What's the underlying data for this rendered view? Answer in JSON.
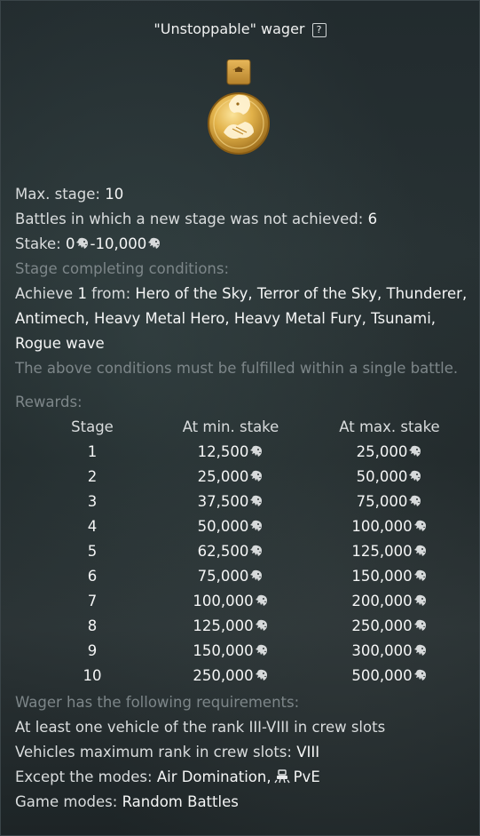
{
  "title": "\"Unstoppable\" wager",
  "help_glyph": "?",
  "medal_icon": "golden-lion-handshake-medal",
  "colors": {
    "muted": "#7d8689",
    "value": "#f4f5f5",
    "gold": "#d7a53a"
  },
  "max_stage": {
    "label": "Max. stage: ",
    "value": "10"
  },
  "battles_not_achieved": {
    "label": "Battles in which a new stage was not achieved: ",
    "value": "6"
  },
  "stake": {
    "label": "Stake: ",
    "min": "0",
    "separator": "-",
    "max": "10,000",
    "currency_icon": "lion-icon"
  },
  "conditions": {
    "title": "Stage completing conditions:",
    "achieve_prefix": "Achieve ",
    "achieve_count": "1",
    "achieve_from": " from: ",
    "list": "Hero of the Sky, Terror of the Sky, Thunderer, Antimech, Heavy Metal Hero, Heavy Metal Fury, Tsunami, Rogue wave",
    "note": "The above conditions must be fulfilled within a single battle."
  },
  "rewards": {
    "title": "Rewards:",
    "headers": [
      "Stage",
      "At min. stake",
      "At max. stake"
    ],
    "rows": [
      {
        "stage": "1",
        "min": "12,500",
        "max": "25,000"
      },
      {
        "stage": "2",
        "min": "25,000",
        "max": "50,000"
      },
      {
        "stage": "3",
        "min": "37,500",
        "max": "75,000"
      },
      {
        "stage": "4",
        "min": "50,000",
        "max": "100,000"
      },
      {
        "stage": "5",
        "min": "62,500",
        "max": "125,000"
      },
      {
        "stage": "6",
        "min": "75,000",
        "max": "150,000"
      },
      {
        "stage": "7",
        "min": "100,000",
        "max": "200,000"
      },
      {
        "stage": "8",
        "min": "125,000",
        "max": "250,000"
      },
      {
        "stage": "9",
        "min": "150,000",
        "max": "300,000"
      },
      {
        "stage": "10",
        "min": "250,000",
        "max": "500,000"
      }
    ]
  },
  "requirements": {
    "title": "Wager has the following requirements:",
    "vehicle_rank": "At least one vehicle of the rank III-VIII in crew slots",
    "max_rank_label": "Vehicles maximum rank in crew slots: ",
    "max_rank_value": "VIII",
    "except_label": "Except the modes: ",
    "except_mode_1": "Air Domination,",
    "except_mode_2": "PvE",
    "except_mode_2_icon": "pve-robot-icon",
    "game_modes_label": "Game modes: ",
    "game_modes_value": "Random Battles"
  }
}
